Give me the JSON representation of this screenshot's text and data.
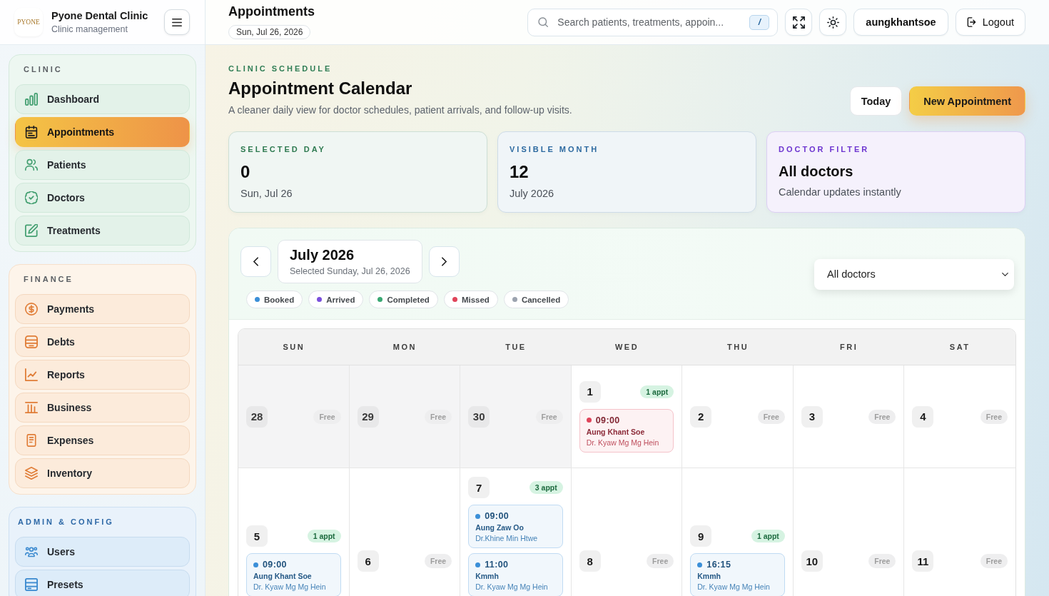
{
  "sidebar": {
    "logo": "PYONE",
    "title": "Pyone Dental Clinic",
    "subtitle": "Clinic management",
    "sections": [
      {
        "title": "CLINIC",
        "items": [
          {
            "label": "Dashboard",
            "selected": false
          },
          {
            "label": "Appointments",
            "selected": true
          },
          {
            "label": "Patients",
            "selected": false
          },
          {
            "label": "Doctors",
            "selected": false
          },
          {
            "label": "Treatments",
            "selected": false
          }
        ]
      },
      {
        "title": "FINANCE",
        "items": [
          {
            "label": "Payments",
            "selected": false
          },
          {
            "label": "Debts",
            "selected": false
          },
          {
            "label": "Reports",
            "selected": false
          },
          {
            "label": "Business",
            "selected": false
          },
          {
            "label": "Expenses",
            "selected": false
          },
          {
            "label": "Inventory",
            "selected": false
          }
        ]
      },
      {
        "title": "ADMIN & CONFIG",
        "items": [
          {
            "label": "Users",
            "selected": false
          },
          {
            "label": "Presets",
            "selected": false
          }
        ]
      }
    ]
  },
  "topbar": {
    "title": "Appointments",
    "date": "Sun, Jul 26, 2026",
    "search": {
      "placeholder": "Search patients, treatments, appoin...",
      "shortcut": "/"
    },
    "user": "aungkhantsoe",
    "logout": "Logout"
  },
  "header": {
    "eyebrow": "CLINIC SCHEDULE",
    "title": "Appointment Calendar",
    "subtitle": "A cleaner daily view for doctor schedules, patient arrivals, and follow-up visits.",
    "buttons": [
      {
        "label": "Today",
        "kind": "secondary"
      },
      {
        "label": "New Appointment",
        "kind": "primary"
      }
    ]
  },
  "stats": [
    {
      "label": "SELECTED DAY",
      "value": "0",
      "note": "Sun, Jul 26",
      "kind": "count",
      "color": "#2e7a50"
    },
    {
      "label": "VISIBLE MONTH",
      "value": "12",
      "note": "July 2026",
      "kind": "count",
      "color": "#2d6aa0"
    },
    {
      "label": "DOCTOR FILTER",
      "value": "All doctors",
      "note": "Calendar updates instantly",
      "kind": "text",
      "color": "#6d35d0"
    }
  ],
  "calendar": {
    "month": "July 2026",
    "selected_text": "Selected Sunday, Jul 26, 2026",
    "doctor_filter": "All doctors",
    "legend": [
      {
        "label": "Booked",
        "color": "#3b8fd8"
      },
      {
        "label": "Arrived",
        "color": "#7a4fdc"
      },
      {
        "label": "Completed",
        "color": "#3aa873"
      },
      {
        "label": "Missed",
        "color": "#e0445a"
      },
      {
        "label": "Cancelled",
        "color": "#9ca3af"
      }
    ],
    "weekdays": [
      "SUN",
      "MON",
      "TUE",
      "WED",
      "THU",
      "FRI",
      "SAT"
    ],
    "weeks": [
      {
        "days": [
          {
            "day": "28",
            "in_month": false,
            "badge": "Free"
          },
          {
            "day": "29",
            "in_month": false,
            "badge": "Free"
          },
          {
            "day": "30",
            "in_month": false,
            "badge": "Free"
          },
          {
            "day": "1",
            "in_month": true,
            "badge": "1 appt",
            "appointments": [
              {
                "time": "09:00",
                "patient": "Aung Khant Soe",
                "doctor": "Dr. Kyaw Mg Mg Hein",
                "color": "#e0445a"
              }
            ]
          },
          {
            "day": "2",
            "in_month": true,
            "badge": "Free"
          },
          {
            "day": "3",
            "in_month": true,
            "badge": "Free"
          },
          {
            "day": "4",
            "in_month": true,
            "badge": "Free"
          }
        ]
      },
      {
        "days": [
          {
            "day": "5",
            "in_month": true,
            "badge": "1 appt",
            "appointments": [
              {
                "time": "09:00",
                "patient": "Aung Khant Soe",
                "doctor": "Dr. Kyaw Mg Mg Hein",
                "color": "#3b8fd8"
              }
            ]
          },
          {
            "day": "6",
            "in_month": true,
            "badge": "Free"
          },
          {
            "day": "7",
            "in_month": true,
            "badge": "3 appt",
            "appointments": [
              {
                "time": "09:00",
                "patient": "Aung Zaw Oo",
                "doctor": "Dr.Khine Min Htwe",
                "color": "#3b8fd8"
              },
              {
                "time": "11:00",
                "patient": "Kmmh",
                "doctor": "Dr. Kyaw Mg Mg Hein",
                "color": "#3b8fd8"
              }
            ]
          },
          {
            "day": "8",
            "in_month": true,
            "badge": "Free"
          },
          {
            "day": "9",
            "in_month": true,
            "badge": "1 appt",
            "appointments": [
              {
                "time": "16:15",
                "patient": "Kmmh",
                "doctor": "Dr. Kyaw Mg Mg Hein",
                "color": "#3b8fd8"
              }
            ]
          },
          {
            "day": "10",
            "in_month": true,
            "badge": "Free"
          },
          {
            "day": "11",
            "in_month": true,
            "badge": "Free"
          }
        ]
      }
    ]
  }
}
